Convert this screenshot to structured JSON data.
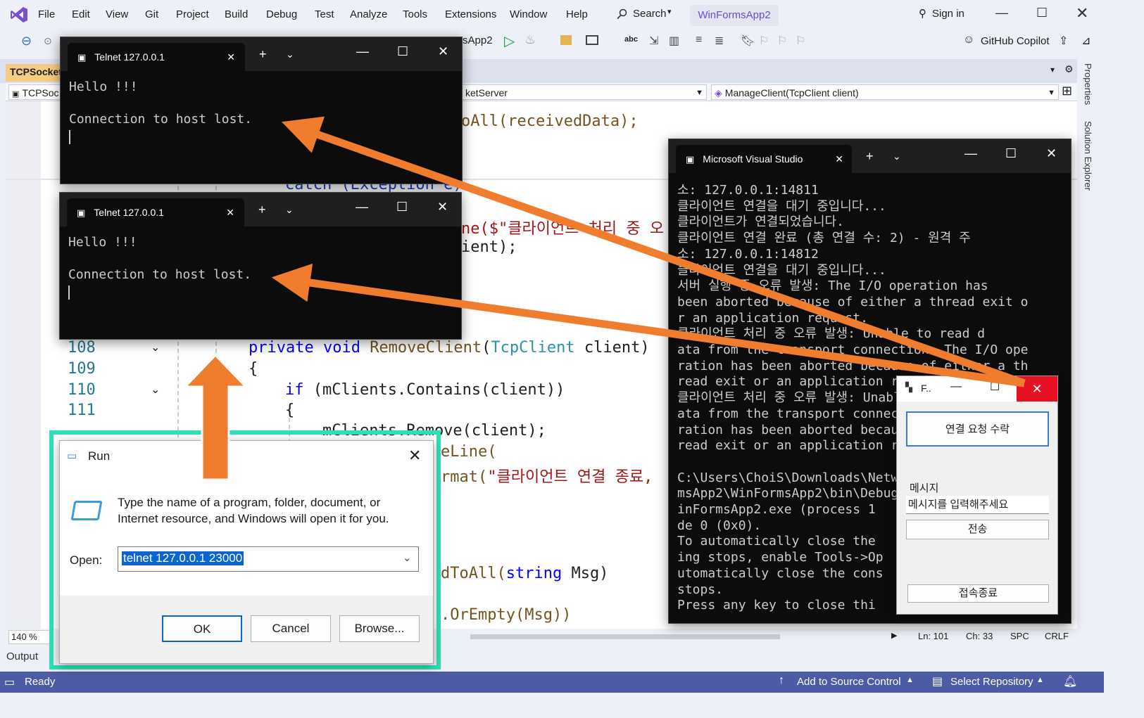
{
  "vs": {
    "menu": [
      "File",
      "Edit",
      "View",
      "Git",
      "Project",
      "Build",
      "Debug",
      "Test",
      "Analyze",
      "Tools",
      "Extensions",
      "Window",
      "Help"
    ],
    "search_label": "Search",
    "project_name": "WinFormsApp2",
    "sign_in": "Sign in",
    "copilot": "GitHub Copilot",
    "startup_project": "sApp2",
    "doc_tab": "TCPSocket",
    "nav_left": "TCPSoc",
    "nav_mid": "ketServer",
    "nav_right": "ManageClient(TcpClient client)",
    "zoom": "140 %",
    "ln": "Ln: 101",
    "ch": "Ch: 33",
    "spc": "SPC",
    "crlf": "CRLF",
    "output_tab": "Output",
    "status_ready": "Ready",
    "add_source": "Add to Source Control",
    "select_repo": "Select Repository",
    "rail_properties": "Properties",
    "rail_solution": "Solution Explorer",
    "colors": {
      "accent": "#4d5aa6",
      "tab_active": "#f5cc84",
      "arrow": "#f07d2e",
      "highlight_frame": "#2fe0b6"
    }
  },
  "code": {
    "frag_1": "oAll(receivedData);",
    "frag_catch": "catch (Exception e)",
    "frag_ne1": "ne($\"클라이언트 처리 중 오",
    "frag_ient": "ient);",
    "line_108": "108",
    "line_109": "109",
    "line_110": "110",
    "line_111": "111",
    "code_108_kw": "private void ",
    "code_108_fn": "RemoveClient",
    "code_108_ty": "TcpClient",
    "code_108_rest": " client)",
    "code_109": "{",
    "code_110_kw": "if",
    "code_110_rest": " (mClients.Contains(client))",
    "code_111": "{",
    "code_112": "mClients.Remove(client);",
    "code_113": "eLine(",
    "code_114a": "rmat(",
    "code_114b": "\"클라이언트 연결 종료,",
    "code_sendall_fn": "dToAll(",
    "code_sendall_kw": "string",
    "code_sendall_rest": " Msg)",
    "code_isnull": ".OrEmpty(Msg))"
  },
  "telnet1": {
    "title": "Telnet 127.0.0.1",
    "line1": "Hello !!!",
    "line2": "Connection to host lost."
  },
  "telnet2": {
    "title": "Telnet 127.0.0.1",
    "line1": "Hello !!!",
    "line2": "Connection to host lost."
  },
  "console": {
    "title": "Microsoft Visual Studio",
    "lines": [
      "소: 127.0.0.1:14811",
      "클라이언트 연결을 대기 중입니다...",
      "클라이언트가 연결되었습니다.",
      "클라이언트 연결 완료 (총 연결 수: 2) - 원격 주",
      "소: 127.0.0.1:14812",
      "클라이언트 연결을 대기 중입니다...",
      "서버 실행 중 오류 발생: The I/O operation has",
      "been aborted because of either a thread exit o",
      "r an application request.",
      "클라이언트 처리 중 오류 발생: Unable to read d",
      "ata from the transport connection: The I/O ope",
      "ration has been aborted because of either a th",
      "read exit or an application request.",
      "클라이언트 처리 중 오류 발생: Unable to read d",
      "ata from the transport connection: The I/O ope",
      "ration has been aborted because of either a th",
      "read exit or an application request.",
      "",
      "C:\\Users\\ChoiS\\Downloads\\NetworkProject\\WinFor",
      "msApp2\\WinFormsApp2\\bin\\Debug\\net8.0-windows\\W",
      "inFormsApp2.exe (process 1",
      "de 0 (0x0).",
      "To automatically close the",
      "ing stops, enable Tools->Op",
      "utomatically close the cons",
      "stops.",
      "Press any key to close thi"
    ]
  },
  "run": {
    "title": "Run",
    "description": "Type the name of a program, folder, document, or Internet resource, and Windows will open it for you.",
    "open_label": "Open:",
    "open_value": "telnet 127.0.0.1 23000",
    "ok": "OK",
    "cancel": "Cancel",
    "browse": "Browse..."
  },
  "form": {
    "title": "F..",
    "accept_button": "연결 요청 수락",
    "message_label": "메시지",
    "message_placeholder": "메시지를 입력해주세요",
    "send_button": "전송",
    "disconnect_button": "접속종료"
  }
}
